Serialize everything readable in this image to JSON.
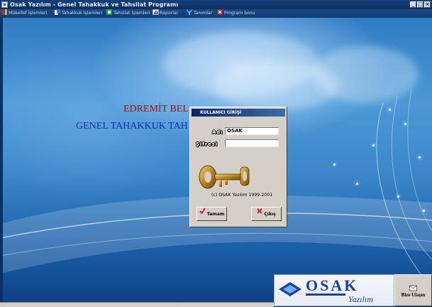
{
  "window": {
    "title": "Osak Yazılım - Genel Tahakkuk ve Tahsilat Programı",
    "controls": [
      "_",
      "□",
      "×"
    ]
  },
  "menu": {
    "items": [
      {
        "label": "Mükellef İşlemleri",
        "icon": "ledger-icon"
      },
      {
        "label": "Tahakkuk İşlemleri",
        "icon": "accrual-icon"
      },
      {
        "label": "Tahsilat İşlemleri",
        "icon": "collection-icon"
      },
      {
        "label": "Raporlar",
        "icon": "report-icon"
      },
      {
        "label": "Tanımlar",
        "icon": "definitions-icon"
      },
      {
        "label": "Program Sonu",
        "icon": "exit-icon"
      }
    ]
  },
  "background": {
    "line1": "EDREMİT BEL",
    "line2": "GENEL TAHAKKUK TAH"
  },
  "login": {
    "title": "KULLANICI GİRİŞİ",
    "name_label": "Adı",
    "name_value": "OSAK",
    "password_label": "Şifresi",
    "password_value": "",
    "copyright": "(c) OSAK Yazılım 1999-2001",
    "ok_label": "Tamam",
    "exit_label": "Çıkış"
  },
  "branding": {
    "logo_main": "OSAK",
    "logo_sub": "Yazılım",
    "contact_label": "Bize Ulaşın"
  },
  "colors": {
    "title_red": "#9a1414",
    "title_blue": "#1530a8",
    "dialog_title_bar": "#0a246a",
    "logo_blue": "#1b3fa8"
  }
}
